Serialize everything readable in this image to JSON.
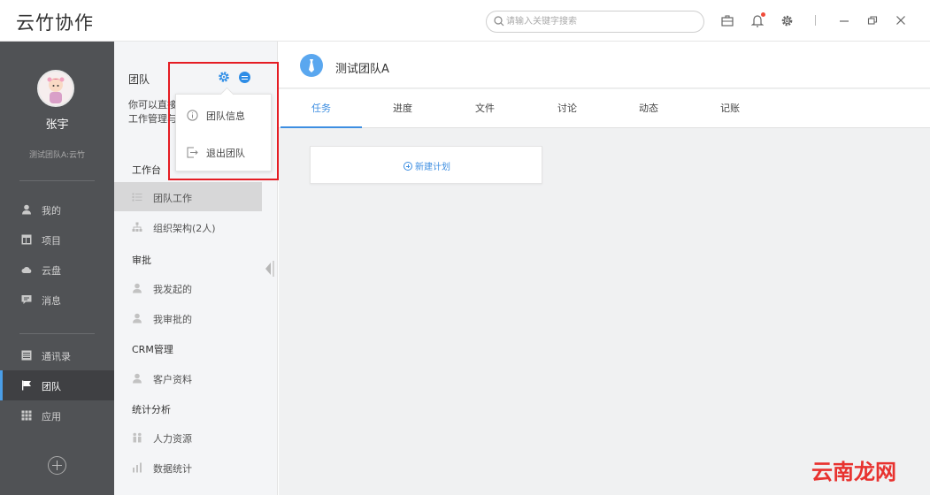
{
  "app": {
    "title": "云竹协作"
  },
  "search": {
    "placeholder": "请输入关键字搜索"
  },
  "user": {
    "name": "张宇",
    "team_line": "测试团队A:云竹"
  },
  "sidebar": {
    "items": [
      {
        "key": "mine",
        "label": "我的",
        "icon": "user-icon"
      },
      {
        "key": "project",
        "label": "项目",
        "icon": "project-icon"
      },
      {
        "key": "cloud",
        "label": "云盘",
        "icon": "cloud-icon"
      },
      {
        "key": "message",
        "label": "消息",
        "icon": "message-icon"
      },
      {
        "key": "contacts",
        "label": "通讯录",
        "icon": "contacts-icon"
      },
      {
        "key": "team",
        "label": "团队",
        "icon": "flag-icon",
        "active": true
      },
      {
        "key": "apps",
        "label": "应用",
        "icon": "grid-icon"
      }
    ]
  },
  "panel": {
    "title": "团队",
    "desc_line1": "你可以直接",
    "desc_line2": "工作管理与",
    "sections": [
      {
        "head": "工作台",
        "items": [
          {
            "label": "团队工作",
            "active": true
          },
          {
            "label": "组织架构(2人)"
          }
        ]
      },
      {
        "head": "审批",
        "items": [
          {
            "label": "我发起的"
          },
          {
            "label": "我审批的"
          }
        ]
      },
      {
        "head": "CRM管理",
        "items": [
          {
            "label": "客户资料"
          }
        ]
      },
      {
        "head": "统计分析",
        "items": [
          {
            "label": "人力资源"
          },
          {
            "label": "数据统计"
          }
        ]
      }
    ]
  },
  "dropdown": {
    "items": [
      {
        "label": "团队信息"
      },
      {
        "label": "退出团队"
      }
    ]
  },
  "main": {
    "team_name": "测试团队A",
    "tabs": [
      {
        "label": "任务",
        "active": true
      },
      {
        "label": "进度"
      },
      {
        "label": "文件"
      },
      {
        "label": "讨论"
      },
      {
        "label": "动态"
      },
      {
        "label": "记账"
      }
    ],
    "new_plan_label": "新建计划"
  },
  "watermark": "云南龙网",
  "colors": {
    "accent": "#3d8ee1",
    "sidebar_bg": "#505255",
    "highlight": "#e51c23"
  }
}
